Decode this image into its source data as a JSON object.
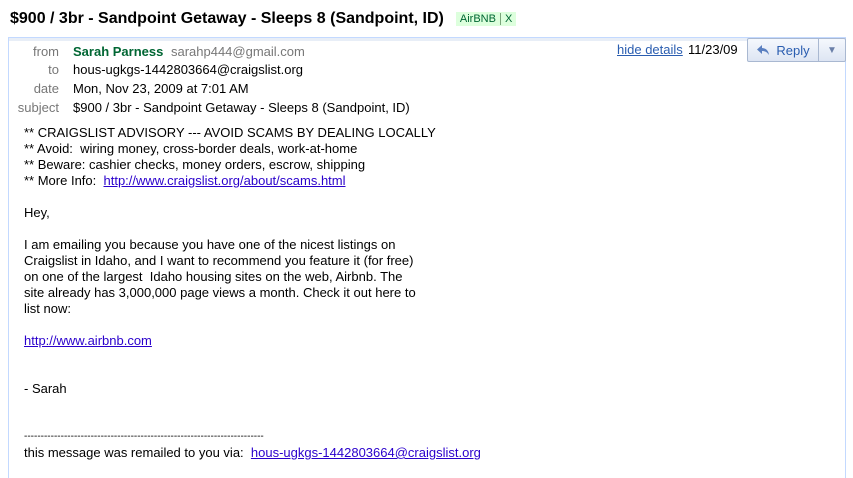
{
  "thread": {
    "subject": "$900 / 3br - Sandpoint Getaway - Sleeps 8 (Sandpoint, ID)",
    "label": "AirBNB",
    "label_remove": "X"
  },
  "message": {
    "from_label": "from",
    "sender_name": "Sarah Parness",
    "sender_email": "sarahp444@gmail.com",
    "to_label": "to",
    "to_value": "hous-ugkgs-1442803664@craigslist.org",
    "date_label": "date",
    "date_value": "Mon, Nov 23, 2009 at 7:01 AM",
    "subject_label": "subject",
    "subject_value": "$900 / 3br - Sandpoint Getaway - Sleeps 8 (Sandpoint, ID)",
    "hide_details": "hide details",
    "short_date": "11/23/09",
    "reply_label": "Reply",
    "reply_more": "▼"
  },
  "body": {
    "advisory_1": "** CRAIGSLIST ADVISORY --- AVOID SCAMS BY DEALING LOCALLY",
    "advisory_2": "** Avoid:  wiring money, cross-border deals, work-at-home",
    "advisory_3": "** Beware: cashier checks, money orders, escrow, shipping",
    "advisory_4_prefix": "** More Info:  ",
    "advisory_4_link": "http://www.craigslist.org/about/scams.html",
    "greeting": "Hey,",
    "para_line_1": "I am emailing you because you have one of the nicest listings on",
    "para_line_2": "Craigslist in Idaho, and I want to recommend you feature it (for free)",
    "para_line_3": "on one of the largest  Idaho housing sites on the web, Airbnb. The",
    "para_line_4": "site already has 3,000,000 page views a month. Check it out here to",
    "para_line_5": "list now:",
    "airbnb_link": "http://www.airbnb.com",
    "signoff": "- Sarah",
    "separator": "------------------------------------------------------------------------",
    "remailed_prefix": "this message was remailed to you via:  ",
    "remailed_link": "hous-ugkgs-1442803664@craigslist.org"
  }
}
